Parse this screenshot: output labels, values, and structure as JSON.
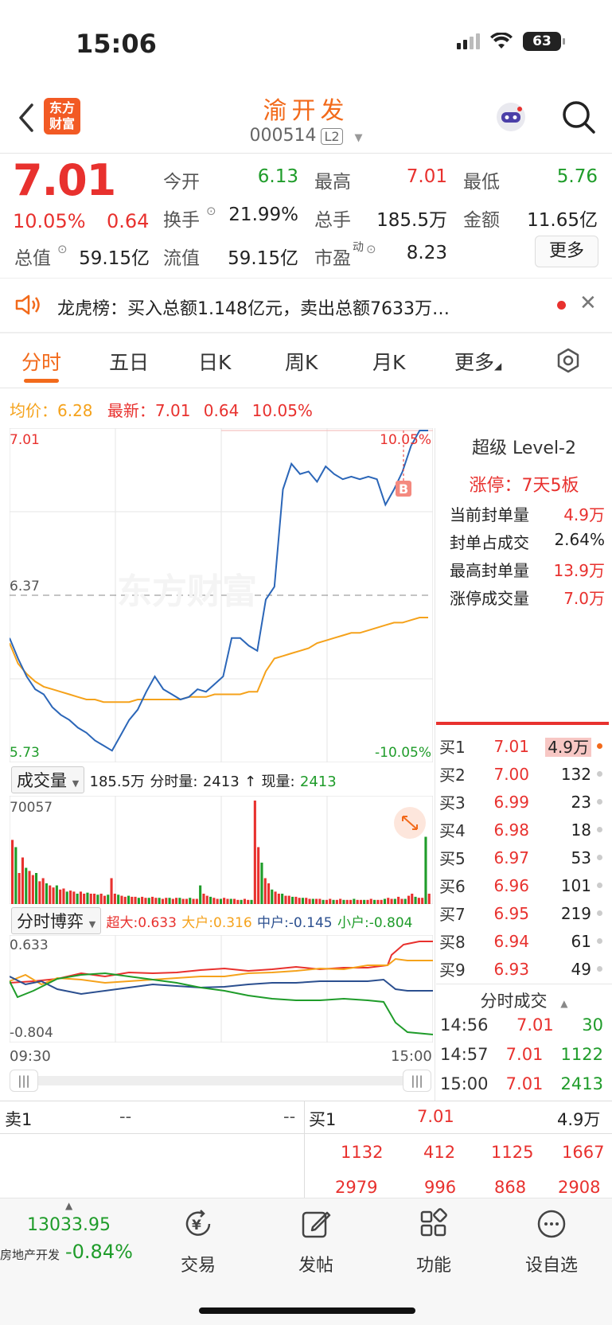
{
  "status": {
    "time": "15:06",
    "battery": "63"
  },
  "header": {
    "logo_line1": "东方",
    "logo_line2": "财富",
    "title": "渝开发",
    "code": "000514",
    "level_badge": "L2"
  },
  "quote": {
    "price": "7.01",
    "change_pct": "10.05%",
    "change": "0.64",
    "open_label": "今开",
    "open": "6.13",
    "high_label": "最高",
    "high": "7.01",
    "low_label": "最低",
    "low": "5.76",
    "turnover_label": "换手",
    "turnover": "21.99%",
    "volume_label": "总手",
    "volume": "185.5万",
    "amount_label": "金额",
    "amount": "11.65亿",
    "mktcap_label": "总值",
    "mktcap": "59.15亿",
    "float_label": "流值",
    "float": "59.15亿",
    "pe_label": "市盈",
    "pe_sup": "动",
    "pe": "8.23",
    "more_button": "更多"
  },
  "news": {
    "text": "龙虎榜：买入总额1.148亿元，卖出总额7633万…"
  },
  "tabs": [
    "分时",
    "五日",
    "日K",
    "周K",
    "月K",
    "更多"
  ],
  "avg_row": {
    "avg_label": "均价：",
    "avg": "6.28",
    "latest_label": "最新：",
    "latest": "7.01",
    "chg": "0.64",
    "pct": "10.05%"
  },
  "chart_data": {
    "type": "line",
    "title": "",
    "y_max_label": "7.01",
    "y_mid_label": "6.37",
    "y_min_label": "5.73",
    "pct_max_label": "10.05%",
    "pct_min_label": "-10.05%",
    "ylim": [
      5.73,
      7.01
    ],
    "x_start": "09:30",
    "x_end": "15:00",
    "price": [
      6.2,
      6.12,
      6.05,
      6.0,
      5.98,
      5.93,
      5.9,
      5.88,
      5.85,
      5.83,
      5.8,
      5.78,
      5.76,
      5.82,
      5.88,
      5.92,
      5.99,
      6.05,
      6.0,
      5.98,
      5.96,
      5.97,
      6.0,
      5.99,
      6.02,
      6.05,
      6.2,
      6.2,
      6.17,
      6.15,
      6.35,
      6.4,
      6.78,
      6.88,
      6.84,
      6.85,
      6.81,
      6.87,
      6.84,
      6.82,
      6.83,
      6.82,
      6.83,
      6.82,
      6.72,
      6.78,
      6.85,
      6.95,
      7.01,
      7.01
    ],
    "avg": [
      6.18,
      6.1,
      6.06,
      6.03,
      6.01,
      6.0,
      5.99,
      5.98,
      5.97,
      5.96,
      5.96,
      5.95,
      5.95,
      5.95,
      5.95,
      5.96,
      5.96,
      5.96,
      5.96,
      5.96,
      5.96,
      5.97,
      5.97,
      5.97,
      5.98,
      5.98,
      5.98,
      5.98,
      5.99,
      5.99,
      6.07,
      6.12,
      6.13,
      6.14,
      6.15,
      6.16,
      6.18,
      6.19,
      6.2,
      6.21,
      6.22,
      6.22,
      6.23,
      6.24,
      6.25,
      6.26,
      6.26,
      6.27,
      6.28,
      6.28
    ],
    "trade_marker": "B"
  },
  "volume": {
    "dropdown": "成交量",
    "total": "185.5万",
    "tick_label": "分时量:",
    "tick": "2413",
    "arrow": "↑",
    "now_label": "现量:",
    "now": "2413",
    "max_label": "70057",
    "bars": [
      0.62,
      0.55,
      0.3,
      0.45,
      0.35,
      0.32,
      0.28,
      0.3,
      0.22,
      0.25,
      0.2,
      0.18,
      0.16,
      0.18,
      0.14,
      0.15,
      0.12,
      0.13,
      0.12,
      0.1,
      0.12,
      0.1,
      0.11,
      0.1,
      0.1,
      0.09,
      0.1,
      0.08,
      0.09,
      0.25,
      0.1,
      0.09,
      0.08,
      0.07,
      0.08,
      0.07,
      0.07,
      0.06,
      0.07,
      0.06,
      0.06,
      0.07,
      0.06,
      0.06,
      0.05,
      0.06,
      0.06,
      0.05,
      0.06,
      0.06,
      0.05,
      0.05,
      0.06,
      0.05,
      0.05,
      0.18,
      0.1,
      0.08,
      0.07,
      0.06,
      0.05,
      0.05,
      0.06,
      0.05,
      0.05,
      0.05,
      0.04,
      0.04,
      0.05,
      0.04,
      0.04,
      1.0,
      0.55,
      0.4,
      0.25,
      0.2,
      0.14,
      0.12,
      0.1,
      0.1,
      0.08,
      0.08,
      0.07,
      0.07,
      0.06,
      0.06,
      0.06,
      0.05,
      0.05,
      0.05,
      0.05,
      0.04,
      0.04,
      0.05,
      0.04,
      0.04,
      0.05,
      0.04,
      0.04,
      0.04,
      0.05,
      0.04,
      0.04,
      0.04,
      0.04,
      0.05,
      0.04,
      0.04,
      0.04,
      0.05,
      0.06,
      0.05,
      0.05,
      0.07,
      0.05,
      0.05,
      0.08,
      0.1,
      0.07,
      0.06,
      0.06,
      0.65,
      0.1
    ]
  },
  "bo": {
    "dropdown": "分时博弈",
    "big_label": "超大:",
    "big": "0.633",
    "large_label": "大户:",
    "large": "0.316",
    "mid_label": "中户:",
    "mid": "-0.145",
    "small_label": "小户:",
    "small": "-0.804",
    "max_label": "0.633",
    "min_label": "-0.804",
    "x_start": "09:30",
    "x_end": "15:00"
  },
  "l2panel": {
    "title": "超级 Level-2",
    "limit": "涨停：7天5板",
    "rows": [
      {
        "label": "当前封单量",
        "value": "4.9万"
      },
      {
        "label": "封单占成交",
        "value": "2.64%"
      },
      {
        "label": "最高封单量",
        "value": "13.9万"
      },
      {
        "label": "涨停成交量",
        "value": "7.0万"
      }
    ]
  },
  "orderbook": [
    {
      "name": "买1",
      "price": "7.01",
      "qty": "4.9万"
    },
    {
      "name": "买2",
      "price": "7.00",
      "qty": "132"
    },
    {
      "name": "买3",
      "price": "6.99",
      "qty": "23"
    },
    {
      "name": "买4",
      "price": "6.98",
      "qty": "18"
    },
    {
      "name": "买5",
      "price": "6.97",
      "qty": "53"
    },
    {
      "name": "买6",
      "price": "6.96",
      "qty": "101"
    },
    {
      "name": "买7",
      "price": "6.95",
      "qty": "219"
    },
    {
      "name": "买8",
      "price": "6.94",
      "qty": "61"
    },
    {
      "name": "买9",
      "price": "6.93",
      "qty": "49"
    }
  ],
  "ticks": {
    "title": "分时成交",
    "rows": [
      {
        "time": "14:56",
        "price": "7.01",
        "qty": "30"
      },
      {
        "time": "14:57",
        "price": "7.01",
        "qty": "1122"
      },
      {
        "time": "15:00",
        "price": "7.01",
        "qty": "2413"
      }
    ]
  },
  "book": {
    "sell_label": "卖1",
    "sell_price": "--",
    "sell_qty": "--",
    "buy_label": "买1",
    "buy_price": "7.01",
    "buy_qty": "4.9万",
    "queue_row1": [
      "1132",
      "412",
      "1125",
      "1667"
    ],
    "queue_row2": [
      "2979",
      "996",
      "868",
      "2908"
    ]
  },
  "bottom": {
    "index_value": "13033.95",
    "index_name": "房地产开发",
    "index_pct": "-0.84%",
    "nav": [
      "交易",
      "发帖",
      "功能",
      "设自选"
    ]
  },
  "colors": {
    "up": "#e8312e",
    "down": "#1f9c2a",
    "price_line": "#2b66b8",
    "avg_line": "#f5a21b",
    "brand": "#f26a1b"
  }
}
